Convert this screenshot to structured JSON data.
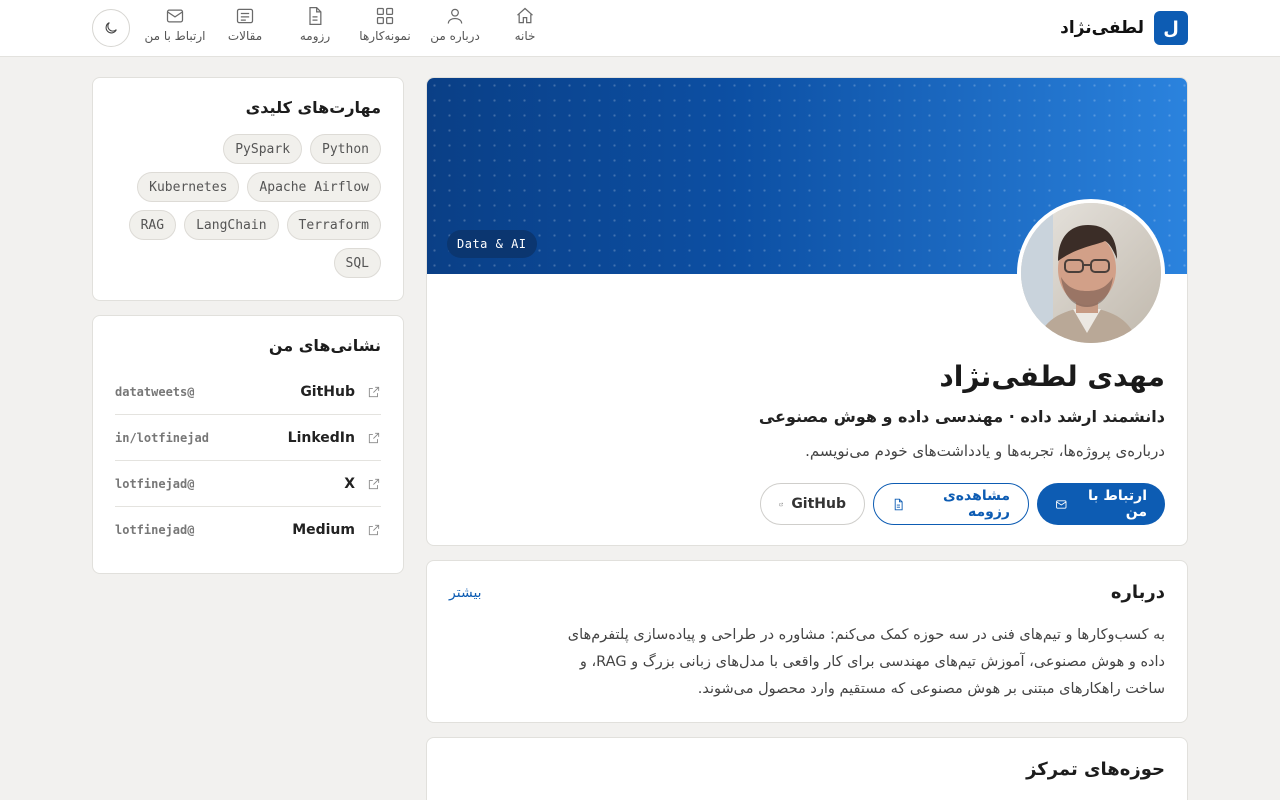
{
  "brand": {
    "mark": "ل",
    "name": "لطفی‌نژاد"
  },
  "nav": [
    {
      "label": "خانه",
      "icon": "home-icon"
    },
    {
      "label": "درباره من",
      "icon": "user-icon"
    },
    {
      "label": "نمونه‌کارها",
      "icon": "grid-icon"
    },
    {
      "label": "رزومه",
      "icon": "document-icon"
    },
    {
      "label": "مقالات",
      "icon": "article-icon"
    },
    {
      "label": "ارتباط با من",
      "icon": "mail-icon"
    }
  ],
  "theme_toggle": {
    "icon": "moon-icon"
  },
  "hero": {
    "tag": "Data & AI",
    "name": "مهدی لطفی‌نژاد",
    "subtitle": "دانشمند ارشد داده · مهندسی داده و هوش مصنوعی",
    "description": "درباره‌ی پروژه‌ها، تجربه‌ها و یادداشت‌های خودم می‌نویسم.",
    "actions": {
      "contact": "ارتباط با من",
      "resume": "مشاهده‌ی رزومه",
      "github": "GitHub"
    },
    "colors": {
      "accent": "#0d5cb3",
      "banner_from": "#0a3f86",
      "banner_to": "#2b83de"
    }
  },
  "about": {
    "title": "درباره",
    "more": "بیشتر",
    "text": "به کسب‌وکارها و تیم‌های فنی در سه حوزه کمک می‌کنم: مشاوره در طراحی و پیاده‌سازی پلتفرم‌های داده و هوش مصنوعی، آموزش تیم‌های مهندسی برای کار واقعی با مدل‌های زبانی بزرگ و RAG، و ساخت راهکارهای مبتنی بر هوش مصنوعی که مستقیم وارد محصول می‌شوند."
  },
  "focus": {
    "title": "حوزه‌های تمرکز"
  },
  "skills": {
    "title": "مهارت‌های کلیدی",
    "items": [
      "Python",
      "PySpark",
      "Apache Airflow",
      "Kubernetes",
      "Terraform",
      "LangChain",
      "RAG",
      "SQL"
    ]
  },
  "links": {
    "title": "نشانی‌های من",
    "items": [
      {
        "name": "GitHub",
        "handle": "datatweets@"
      },
      {
        "name": "LinkedIn",
        "handle": "in/lotfinejad"
      },
      {
        "name": "X",
        "handle": "lotfinejad@"
      },
      {
        "name": "Medium",
        "handle": "lotfinejad@"
      }
    ]
  }
}
